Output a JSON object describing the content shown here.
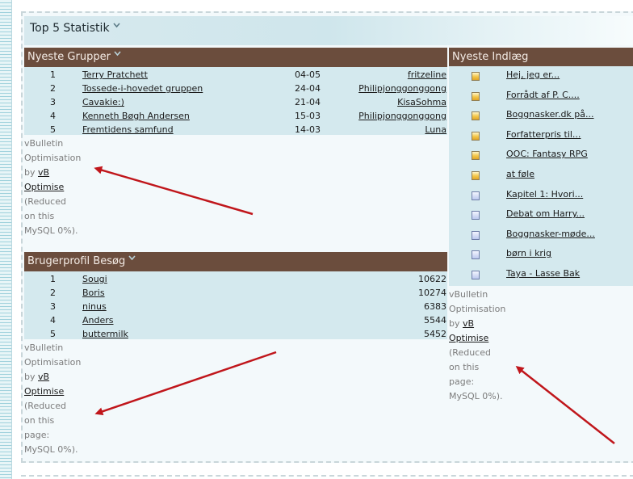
{
  "top_title": "Top 5 Statistik",
  "groups": {
    "title": "Nyeste Grupper",
    "rows": [
      {
        "n": "1",
        "name": "Terry Pratchett",
        "date": "04-05",
        "user": "fritzeline"
      },
      {
        "n": "2",
        "name": "Tossede-i-hovedet gruppen",
        "date": "24-04",
        "user": "Philipjonggonggong"
      },
      {
        "n": "3",
        "name": "Cavakie:)",
        "date": "21-04",
        "user": "KisaSohma"
      },
      {
        "n": "4",
        "name": "Kenneth Bøgh Andersen",
        "date": "15-03",
        "user": "Philipjonggonggong"
      },
      {
        "n": "5",
        "name": "Fremtidens samfund",
        "date": "14-03",
        "user": "Luna"
      }
    ]
  },
  "visits": {
    "title": "Brugerprofil Besøg",
    "rows": [
      {
        "n": "1",
        "name": "Sougi",
        "count": "10622"
      },
      {
        "n": "2",
        "name": "Boris",
        "count": "10274"
      },
      {
        "n": "3",
        "name": "ninus",
        "count": "6383"
      },
      {
        "n": "4",
        "name": "Anders",
        "count": "5544"
      },
      {
        "n": "5",
        "name": "buttermilk",
        "count": "5452"
      }
    ]
  },
  "posts": {
    "title": "Nyeste Indlæg",
    "items": [
      {
        "title": "Hej, jeg er...",
        "icon": "hot-doc-icon"
      },
      {
        "title": "Forrådt af P. C....",
        "icon": "hot-doc-icon"
      },
      {
        "title": "Boggnasker.dk på...",
        "icon": "hot-doc-icon"
      },
      {
        "title": "Forfatterpris til...",
        "icon": "hot-doc-icon"
      },
      {
        "title": "OOC: Fantasy RPG",
        "icon": "hot-doc-icon"
      },
      {
        "title": "at føle",
        "icon": "hot-doc-icon"
      },
      {
        "title": "Kapitel 1: Hvori...",
        "icon": "doc-icon"
      },
      {
        "title": "Debat om Harry...",
        "icon": "doc-icon"
      },
      {
        "title": "Boggnasker-møde...",
        "icon": "doc-icon"
      },
      {
        "title": "børn i krig",
        "icon": "doc-icon"
      },
      {
        "title": "Taya - Lasse Bak",
        "icon": "doc-icon"
      }
    ]
  },
  "vb_notice": {
    "l1": "vBulletin",
    "l2": "Optimisation",
    "by": "by",
    "link1": "vB",
    "link2": "Optimise",
    "l3": "(Reduced",
    "l4": "on this",
    "l5": "page:",
    "l6": "MySQL 0%)."
  },
  "colors": {
    "header_brown": "#6b4d3d",
    "row_bg": "#d4e9ee",
    "arrow_red": "#c0161b"
  }
}
